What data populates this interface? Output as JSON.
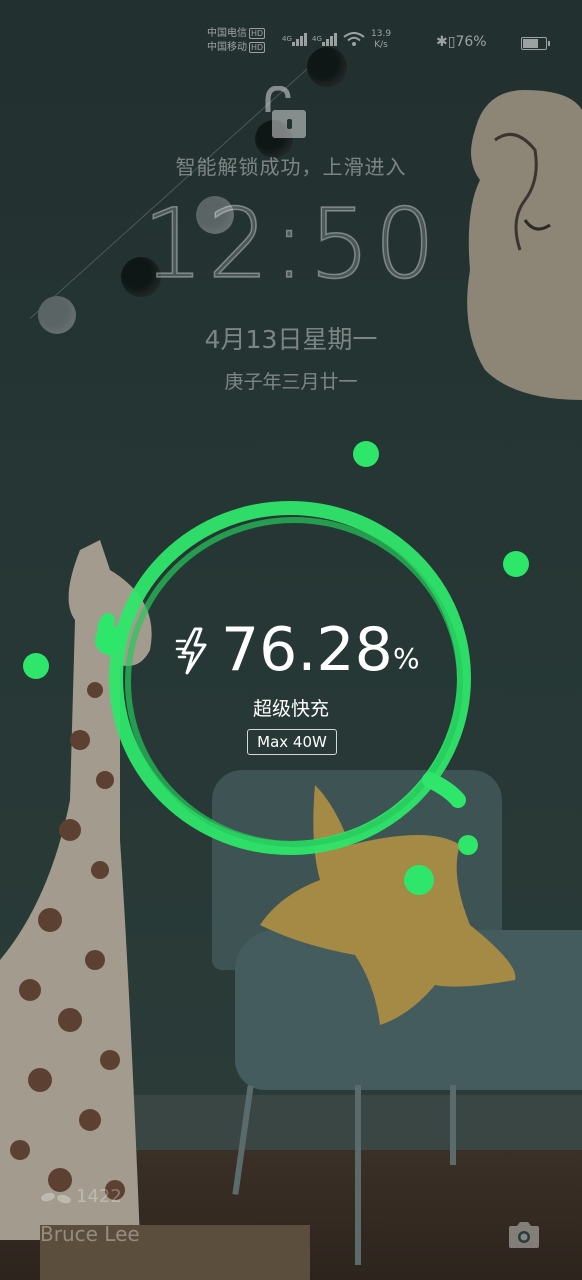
{
  "status_bar": {
    "carrier_1": "中国电信",
    "carrier_2": "中国移动",
    "hd_label": "HD",
    "net_speed_value": "13.9",
    "net_speed_unit": "K/s",
    "battery_percent": "76%",
    "battery_level": 0.76
  },
  "lockscreen": {
    "unlock_hint": "智能解锁成功，上滑进入",
    "time": "12:50",
    "date": "4月13日星期一",
    "lunar_date": "庚子年三月廿一"
  },
  "charging": {
    "percent_value": "76.28",
    "percent_sign": "%",
    "mode_label": "超级快充",
    "max_power": "Max 40W",
    "ring_color": "#2ee66a"
  },
  "footer": {
    "step_count": "1422",
    "owner_name": "Bruce Lee"
  },
  "icons": {
    "lock": "unlocked-padlock-icon",
    "camera": "camera-icon",
    "steps": "footsteps-icon",
    "bluetooth": "bluetooth-icon",
    "vibrate": "vibrate-icon",
    "wifi": "wifi-icon"
  }
}
